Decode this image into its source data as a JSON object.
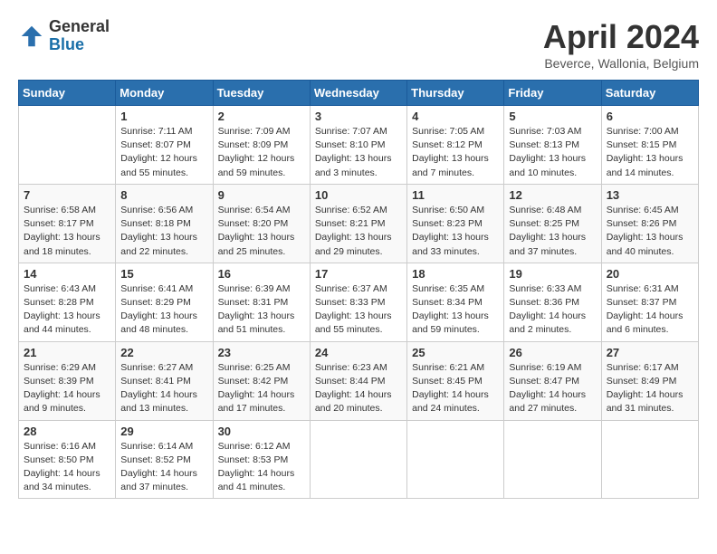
{
  "header": {
    "logo_general": "General",
    "logo_blue": "Blue",
    "month_title": "April 2024",
    "subtitle": "Beverce, Wallonia, Belgium"
  },
  "calendar": {
    "days_of_week": [
      "Sunday",
      "Monday",
      "Tuesday",
      "Wednesday",
      "Thursday",
      "Friday",
      "Saturday"
    ],
    "weeks": [
      [
        {
          "day": "",
          "detail": ""
        },
        {
          "day": "1",
          "detail": "Sunrise: 7:11 AM\nSunset: 8:07 PM\nDaylight: 12 hours\nand 55 minutes."
        },
        {
          "day": "2",
          "detail": "Sunrise: 7:09 AM\nSunset: 8:09 PM\nDaylight: 12 hours\nand 59 minutes."
        },
        {
          "day": "3",
          "detail": "Sunrise: 7:07 AM\nSunset: 8:10 PM\nDaylight: 13 hours\nand 3 minutes."
        },
        {
          "day": "4",
          "detail": "Sunrise: 7:05 AM\nSunset: 8:12 PM\nDaylight: 13 hours\nand 7 minutes."
        },
        {
          "day": "5",
          "detail": "Sunrise: 7:03 AM\nSunset: 8:13 PM\nDaylight: 13 hours\nand 10 minutes."
        },
        {
          "day": "6",
          "detail": "Sunrise: 7:00 AM\nSunset: 8:15 PM\nDaylight: 13 hours\nand 14 minutes."
        }
      ],
      [
        {
          "day": "7",
          "detail": "Sunrise: 6:58 AM\nSunset: 8:17 PM\nDaylight: 13 hours\nand 18 minutes."
        },
        {
          "day": "8",
          "detail": "Sunrise: 6:56 AM\nSunset: 8:18 PM\nDaylight: 13 hours\nand 22 minutes."
        },
        {
          "day": "9",
          "detail": "Sunrise: 6:54 AM\nSunset: 8:20 PM\nDaylight: 13 hours\nand 25 minutes."
        },
        {
          "day": "10",
          "detail": "Sunrise: 6:52 AM\nSunset: 8:21 PM\nDaylight: 13 hours\nand 29 minutes."
        },
        {
          "day": "11",
          "detail": "Sunrise: 6:50 AM\nSunset: 8:23 PM\nDaylight: 13 hours\nand 33 minutes."
        },
        {
          "day": "12",
          "detail": "Sunrise: 6:48 AM\nSunset: 8:25 PM\nDaylight: 13 hours\nand 37 minutes."
        },
        {
          "day": "13",
          "detail": "Sunrise: 6:45 AM\nSunset: 8:26 PM\nDaylight: 13 hours\nand 40 minutes."
        }
      ],
      [
        {
          "day": "14",
          "detail": "Sunrise: 6:43 AM\nSunset: 8:28 PM\nDaylight: 13 hours\nand 44 minutes."
        },
        {
          "day": "15",
          "detail": "Sunrise: 6:41 AM\nSunset: 8:29 PM\nDaylight: 13 hours\nand 48 minutes."
        },
        {
          "day": "16",
          "detail": "Sunrise: 6:39 AM\nSunset: 8:31 PM\nDaylight: 13 hours\nand 51 minutes."
        },
        {
          "day": "17",
          "detail": "Sunrise: 6:37 AM\nSunset: 8:33 PM\nDaylight: 13 hours\nand 55 minutes."
        },
        {
          "day": "18",
          "detail": "Sunrise: 6:35 AM\nSunset: 8:34 PM\nDaylight: 13 hours\nand 59 minutes."
        },
        {
          "day": "19",
          "detail": "Sunrise: 6:33 AM\nSunset: 8:36 PM\nDaylight: 14 hours\nand 2 minutes."
        },
        {
          "day": "20",
          "detail": "Sunrise: 6:31 AM\nSunset: 8:37 PM\nDaylight: 14 hours\nand 6 minutes."
        }
      ],
      [
        {
          "day": "21",
          "detail": "Sunrise: 6:29 AM\nSunset: 8:39 PM\nDaylight: 14 hours\nand 9 minutes."
        },
        {
          "day": "22",
          "detail": "Sunrise: 6:27 AM\nSunset: 8:41 PM\nDaylight: 14 hours\nand 13 minutes."
        },
        {
          "day": "23",
          "detail": "Sunrise: 6:25 AM\nSunset: 8:42 PM\nDaylight: 14 hours\nand 17 minutes."
        },
        {
          "day": "24",
          "detail": "Sunrise: 6:23 AM\nSunset: 8:44 PM\nDaylight: 14 hours\nand 20 minutes."
        },
        {
          "day": "25",
          "detail": "Sunrise: 6:21 AM\nSunset: 8:45 PM\nDaylight: 14 hours\nand 24 minutes."
        },
        {
          "day": "26",
          "detail": "Sunrise: 6:19 AM\nSunset: 8:47 PM\nDaylight: 14 hours\nand 27 minutes."
        },
        {
          "day": "27",
          "detail": "Sunrise: 6:17 AM\nSunset: 8:49 PM\nDaylight: 14 hours\nand 31 minutes."
        }
      ],
      [
        {
          "day": "28",
          "detail": "Sunrise: 6:16 AM\nSunset: 8:50 PM\nDaylight: 14 hours\nand 34 minutes."
        },
        {
          "day": "29",
          "detail": "Sunrise: 6:14 AM\nSunset: 8:52 PM\nDaylight: 14 hours\nand 37 minutes."
        },
        {
          "day": "30",
          "detail": "Sunrise: 6:12 AM\nSunset: 8:53 PM\nDaylight: 14 hours\nand 41 minutes."
        },
        {
          "day": "",
          "detail": ""
        },
        {
          "day": "",
          "detail": ""
        },
        {
          "day": "",
          "detail": ""
        },
        {
          "day": "",
          "detail": ""
        }
      ]
    ]
  }
}
